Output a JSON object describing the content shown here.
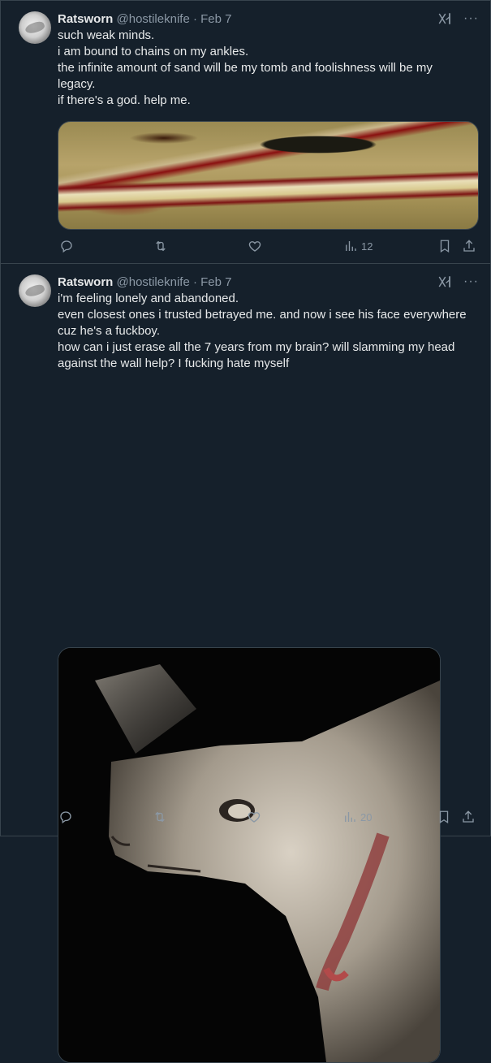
{
  "tweets": [
    {
      "author_name": "Ratsworn",
      "handle": "@hostileknife",
      "separator": "·",
      "date": "Feb 7",
      "more": "···",
      "text_lines": [
        "such weak minds.",
        "i am bound to chains on my ankles.",
        "the infinite amount of sand will be my tomb and foolishness will be my",
        "legacy.",
        "if there's a god. help me."
      ],
      "views": "12"
    },
    {
      "author_name": "Ratsworn",
      "handle": "@hostileknife",
      "separator": "·",
      "date": "Feb 7",
      "more": "···",
      "text_lines": [
        "i'm feeling lonely and abandoned.",
        "even closest ones i trusted betrayed me. and now i see his face everywhere",
        "cuz he's a fuckboy.",
        "how can i just erase all the 7 years from my brain? will slamming my head",
        "against the wall help?  I fucking hate myself"
      ],
      "views": "20"
    }
  ],
  "colors": {
    "background": "#15202b",
    "border": "#38444d",
    "text": "#e7e9ea",
    "secondary": "#8b98a5"
  },
  "icons": [
    "grok-icon",
    "more-icon",
    "reply-icon",
    "repost-icon",
    "like-icon",
    "views-icon",
    "bookmark-icon",
    "share-icon"
  ]
}
